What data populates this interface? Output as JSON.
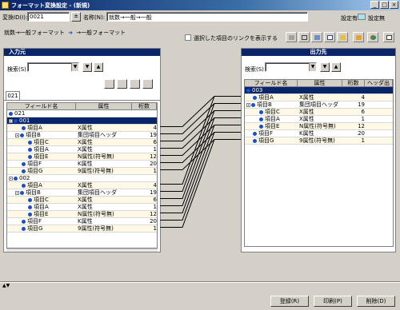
{
  "window": {
    "title": "フォーマット変換設定 - (新規)"
  },
  "header": {
    "id_label": "変換ID(I):",
    "id_value": "0021",
    "name_label": "名称(N):",
    "name_value": "就数→一般→一般",
    "setting_label": "設定有",
    "setting_none_label": "設定無"
  },
  "breadcrumb": {
    "from": "就数→一般フォーマット",
    "to": "→一般フォーマット"
  },
  "toolbar": {
    "show_links_label": "選択した項目のリンクを表示する"
  },
  "input_panel": {
    "title": "入力元",
    "search_label": "検索(S)",
    "tab": "021",
    "columns": [
      "フィールド名",
      "属性",
      "桁数"
    ],
    "rows": [
      {
        "name": "021",
        "attr": "",
        "digits": "",
        "indent": 0,
        "type": "dot",
        "style": ""
      },
      {
        "name": "001",
        "attr": "",
        "digits": "",
        "indent": 0,
        "type": "grp",
        "style": "sel"
      },
      {
        "name": "項目A",
        "attr": "X属性",
        "digits": "4",
        "indent": 2,
        "type": "dot",
        "style": "alt"
      },
      {
        "name": "項目B",
        "attr": "集団項目ヘッダ",
        "digits": "19",
        "indent": 1,
        "type": "grp",
        "style": ""
      },
      {
        "name": "項目C",
        "attr": "X属性",
        "digits": "6",
        "indent": 3,
        "type": "dot",
        "style": "alt"
      },
      {
        "name": "項目A",
        "attr": "X属性",
        "digits": "1",
        "indent": 3,
        "type": "dot",
        "style": ""
      },
      {
        "name": "項目E",
        "attr": "N属性(符号無)",
        "digits": "12",
        "indent": 3,
        "type": "dot",
        "style": "alt"
      },
      {
        "name": "項目F",
        "attr": "K属性",
        "digits": "20",
        "indent": 2,
        "type": "dot",
        "style": ""
      },
      {
        "name": "項目G",
        "attr": "9属性(符号無)",
        "digits": "1",
        "indent": 2,
        "type": "dot",
        "style": "alt"
      },
      {
        "name": "002",
        "attr": "",
        "digits": "",
        "indent": 0,
        "type": "grp",
        "style": ""
      },
      {
        "name": "項目A",
        "attr": "X属性",
        "digits": "4",
        "indent": 2,
        "type": "dot",
        "style": "alt"
      },
      {
        "name": "項目B",
        "attr": "集団項目ヘッダ",
        "digits": "19",
        "indent": 1,
        "type": "grp",
        "style": ""
      },
      {
        "name": "項目C",
        "attr": "X属性",
        "digits": "6",
        "indent": 3,
        "type": "dot",
        "style": "alt"
      },
      {
        "name": "項目A",
        "attr": "X属性",
        "digits": "1",
        "indent": 3,
        "type": "dot",
        "style": ""
      },
      {
        "name": "項目E",
        "attr": "N属性(符号無)",
        "digits": "12",
        "indent": 3,
        "type": "dot",
        "style": "alt"
      },
      {
        "name": "項目F",
        "attr": "K属性",
        "digits": "20",
        "indent": 2,
        "type": "dot",
        "style": ""
      },
      {
        "name": "項目G",
        "attr": "9属性(符号無)",
        "digits": "1",
        "indent": 2,
        "type": "dot",
        "style": "alt"
      }
    ]
  },
  "output_panel": {
    "title": "出力先",
    "search_label": "検索(S)",
    "columns": [
      "フィールド名",
      "属性",
      "桁数",
      "ヘッダ出力"
    ],
    "rows": [
      {
        "name": "003",
        "attr": "",
        "digits": "",
        "indent": 0,
        "type": "dot",
        "style": "sel"
      },
      {
        "name": "項目A",
        "attr": "X属性",
        "digits": "4",
        "indent": 1,
        "type": "dot",
        "style": "alt"
      },
      {
        "name": "項目B",
        "attr": "集団項目ヘッダ",
        "digits": "19",
        "indent": 0,
        "type": "grp",
        "style": ""
      },
      {
        "name": "項目C",
        "attr": "X属性",
        "digits": "6",
        "indent": 2,
        "type": "dot",
        "style": "alt"
      },
      {
        "name": "項目A",
        "attr": "X属性",
        "digits": "1",
        "indent": 2,
        "type": "dot",
        "style": ""
      },
      {
        "name": "項目E",
        "attr": "N属性(符号無)",
        "digits": "12",
        "indent": 2,
        "type": "dot",
        "style": "alt"
      },
      {
        "name": "項目F",
        "attr": "K属性",
        "digits": "20",
        "indent": 1,
        "type": "dot",
        "style": ""
      },
      {
        "name": "項目G",
        "attr": "9属性(符号無)",
        "digits": "1",
        "indent": 1,
        "type": "dot",
        "style": "alt"
      }
    ]
  },
  "footer": {
    "register": "登録(R)",
    "print": "印刷(P)",
    "delete": "削除(D)"
  },
  "colors": {
    "title_blue": "#0a246a",
    "dot_blue": "#1a4fc8",
    "legend_cyan": "#a6e4f4"
  }
}
